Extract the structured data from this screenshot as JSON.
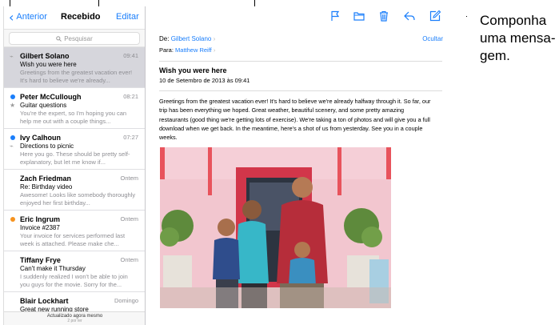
{
  "nav": {
    "back_label": "Anterior",
    "title": "Recebido",
    "edit_label": "Editar"
  },
  "search": {
    "placeholder": "Pesquisar"
  },
  "messages": [
    {
      "sender": "Gilbert Solano",
      "time": "09:41",
      "subject": "Wish you were here",
      "preview": "Greetings from the greatest vacation ever! It's hard to believe we're already...",
      "status": "read",
      "selected": true,
      "attachment": true
    },
    {
      "sender": "Peter McCullough",
      "time": "08:21",
      "subject": "Guitar questions",
      "preview": "You're the expert, so I'm hoping you can help me out with a couple things...",
      "status": "unread",
      "flagged": true
    },
    {
      "sender": "Ivy Calhoun",
      "time": "07:27",
      "subject": "Directions to picnic",
      "preview": "Here you go. These should be pretty self-explanatory, but let me know if...",
      "status": "unread",
      "attachment": true
    },
    {
      "sender": "Zach Friedman",
      "time": "Ontem",
      "subject": "Re: Birthday video",
      "preview": "Awesome! Looks like somebody thoroughly enjoyed her first birthday...",
      "status": "read"
    },
    {
      "sender": "Eric Ingrum",
      "time": "Ontem",
      "subject": "Invoice #2387",
      "preview": "Your invoice for services performed last week is attached. Please make che...",
      "status": "orange"
    },
    {
      "sender": "Tiffany Frye",
      "time": "Ontem",
      "subject": "Can't make it Thursday",
      "preview": "I suddenly realized I won't be able to join you guys for the movie. Sorry for the...",
      "status": "read"
    },
    {
      "sender": "Blair Lockhart",
      "time": "Domingo",
      "subject": "Great new running store",
      "preview": "",
      "status": "read"
    }
  ],
  "status_bar": {
    "line1": "Actualizado agora mesmo",
    "line2": "2 por ler"
  },
  "email": {
    "from_label": "De:",
    "from_name": "Gilbert Solano",
    "to_label": "Para:",
    "to_name": "Matthew Reiff",
    "hide_label": "Ocultar",
    "subject": "Wish you were here",
    "date": "10 de Setembro de 2013 às 09:41",
    "body": "Greetings from the greatest vacation ever! It's hard to believe we're already halfway through it. So far, our trip has been everything we hoped. Great weather, beautiful scenery, and some pretty amazing restaurants (good thing we're getting lots of exercise). We're taking a ton of photos and will give you a full download when we get back. In the meantime, here's a shot of us from yesterday. See you in a couple weeks."
  },
  "toolbar": {
    "icons": [
      "flag-icon",
      "folder-icon",
      "trash-icon",
      "reply-icon",
      "compose-icon"
    ]
  },
  "annotation": {
    "compose_lines": [
      "Componha",
      "uma mensa-",
      "gem."
    ]
  },
  "colors": {
    "accent": "#1a7efb",
    "unread_dot": "#1a7efb",
    "orange_dot": "#f6921e",
    "selected_row": "#d6d6dc"
  }
}
